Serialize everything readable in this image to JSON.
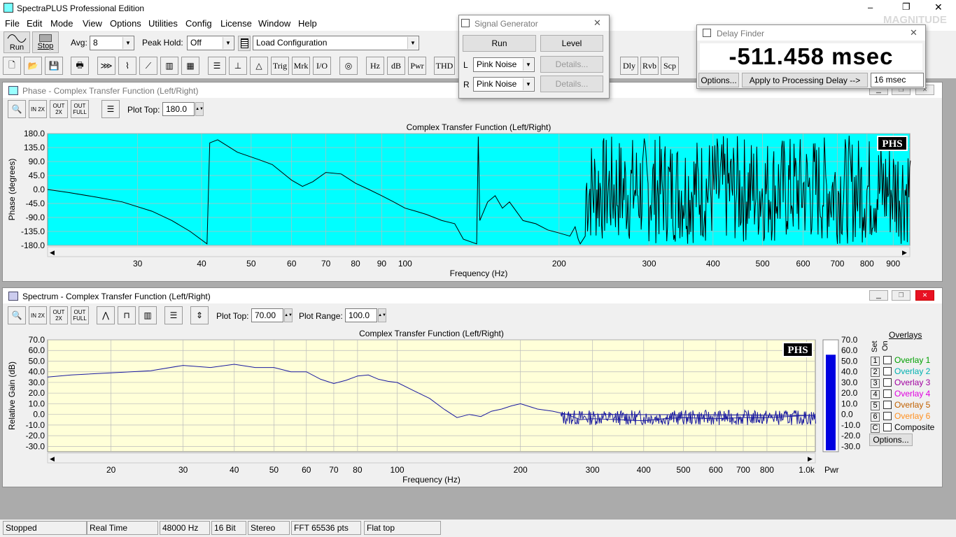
{
  "app": {
    "title": "SpectraPLUS Professional Edition"
  },
  "window_controls": {
    "minimize": "‒",
    "restore": "❐",
    "close": "✕"
  },
  "menu": [
    "File",
    "Edit",
    "Mode",
    "View",
    "Options",
    "Utilities",
    "Config",
    "License",
    "Window",
    "Help"
  ],
  "toolbar1": {
    "run": "Run",
    "stop": "Stop",
    "avg_label": "Avg:",
    "avg_value": "8",
    "peak_label": "Peak Hold:",
    "peak_value": "Off",
    "config_value": "Load Configuration"
  },
  "toolbar2": {
    "buttons": [
      "Trig",
      "Mrk",
      "I/O",
      "Hz",
      "dB",
      "Pwr",
      "THD",
      "Dly",
      "Rvb",
      "Scp"
    ]
  },
  "signal_generator": {
    "title": "Signal Generator",
    "run": "Run",
    "level": "Level",
    "l_label": "L",
    "r_label": "R",
    "l_value": "Pink Noise",
    "r_value": "Pink Noise",
    "details": "Details..."
  },
  "delay_finder": {
    "title": "Delay Finder",
    "value": "-511.458 msec",
    "options": "Options...",
    "apply": "Apply to Processing Delay -->",
    "delay_value": "16 msec"
  },
  "watermark": {
    "text": "MAGNITUDE Sound Team"
  },
  "phase_window": {
    "title": "Phase - Complex Transfer Function (Left/Right)",
    "plot_top_label": "Plot Top:",
    "plot_top_value": "180.0",
    "zoom_buttons": [
      "IN 2X",
      "OUT 2X",
      "OUT FULL"
    ],
    "badge": "PHS"
  },
  "spectrum_window": {
    "title": "Spectrum - Complex Transfer Function (Left/Right)",
    "plot_top_label": "Plot Top:",
    "plot_top_value": "70.00",
    "plot_range_label": "Plot Range:",
    "plot_range_value": "100.0",
    "zoom_buttons": [
      "IN 2X",
      "OUT 2X",
      "OUT FULL"
    ],
    "badge": "PHS",
    "pwr_label": "Pwr"
  },
  "overlays": {
    "title": "Overlays",
    "set_label": "Set",
    "on_label": "On",
    "items": [
      {
        "num": "1",
        "label": "Overlay 1",
        "color": "#00a000"
      },
      {
        "num": "2",
        "label": "Overlay 2",
        "color": "#00b0b0"
      },
      {
        "num": "3",
        "label": "Overlay 3",
        "color": "#a000a0"
      },
      {
        "num": "4",
        "label": "Overlay 4",
        "color": "#e000e0"
      },
      {
        "num": "5",
        "label": "Overlay 5",
        "color": "#c06000"
      },
      {
        "num": "6",
        "label": "Overlay 6",
        "color": "#ff9020"
      },
      {
        "num": "C",
        "label": "Composite",
        "color": "#000000"
      }
    ],
    "options": "Options..."
  },
  "status": [
    "Stopped",
    "Real Time",
    "48000 Hz",
    "16 Bit",
    "Stereo",
    "FFT 65536 pts",
    "Flat top"
  ],
  "chart_data": [
    {
      "type": "line",
      "title": "Complex Transfer Function (Left/Right)",
      "xlabel": "Frequency (Hz)",
      "ylabel": "Phase (degrees)",
      "x_scale": "log",
      "xlim": [
        20,
        970
      ],
      "ylim": [
        -180,
        180
      ],
      "yticks": [
        "180.0",
        "135.0",
        "90.0",
        "45.0",
        "0.0",
        "-45.0",
        "-90.0",
        "-135.0",
        "-180.0"
      ],
      "xticks": [
        "30",
        "40",
        "50",
        "60",
        "70",
        "80",
        "90",
        "100",
        "200",
        "300",
        "400",
        "500",
        "600",
        "700",
        "800",
        "900"
      ],
      "background": "#00ffff",
      "line_color": "#000000",
      "series": [
        {
          "x": [
            20,
            22,
            25,
            28,
            32,
            35,
            38,
            41,
            41.5,
            43,
            47,
            52,
            55,
            60,
            63,
            66,
            70,
            75,
            80,
            85,
            90,
            95,
            100,
            105,
            110,
            118,
            125,
            130,
            138,
            139,
            140,
            145,
            150,
            155,
            160,
            170,
            180,
            190,
            200,
            210,
            215,
            218,
            220,
            225
          ],
          "y": [
            0,
            -10,
            -25,
            -40,
            -70,
            -100,
            -135,
            -175,
            150,
            160,
            120,
            95,
            80,
            30,
            10,
            25,
            55,
            50,
            20,
            0,
            -20,
            -40,
            -60,
            -70,
            -80,
            -100,
            -110,
            -160,
            -175,
            170,
            -100,
            -40,
            -20,
            -60,
            -40,
            -100,
            -110,
            -130,
            -140,
            -150,
            -120,
            -160,
            -175,
            -150
          ]
        }
      ]
    },
    {
      "type": "line",
      "title": "Complex Transfer Function (Left/Right)",
      "xlabel": "Frequency (Hz)",
      "ylabel": "Relative Gain (dB)",
      "x_scale": "log",
      "xlim": [
        14,
        1050
      ],
      "ylim": [
        -35,
        70
      ],
      "yticks": [
        "70.0",
        "60.0",
        "50.0",
        "40.0",
        "30.0",
        "20.0",
        "10.0",
        "0.0",
        "-10.0",
        "-20.0",
        "-30.0"
      ],
      "xticks": [
        "20",
        "30",
        "40",
        "50",
        "60",
        "70",
        "80",
        "100",
        "200",
        "300",
        "400",
        "500",
        "600",
        "700",
        "800",
        "1.0k"
      ],
      "background": "#ffffd8",
      "line_color": "#1a1aa0",
      "series": [
        {
          "x": [
            14,
            16,
            20,
            25,
            30,
            35,
            40,
            45,
            50,
            55,
            60,
            65,
            70,
            75,
            80,
            85,
            90,
            95,
            100,
            110,
            120,
            130,
            140,
            150,
            160,
            170,
            180,
            190,
            200,
            220,
            240,
            260,
            280,
            300,
            350,
            400,
            450,
            500,
            600,
            700,
            800,
            900,
            1000,
            1050
          ],
          "y": [
            35,
            37,
            39,
            41,
            46,
            44,
            47,
            44,
            44,
            40,
            40,
            33,
            29,
            32,
            36,
            37,
            33,
            31,
            30,
            22,
            15,
            5,
            -3,
            0,
            -2,
            3,
            5,
            8,
            10,
            5,
            3,
            0,
            -5,
            -4,
            -5,
            -6,
            -4,
            -3,
            -4,
            -3,
            -3,
            -2,
            -1,
            -1
          ]
        }
      ],
      "level_meter": {
        "label": "Pwr",
        "yticks": [
          "70.0",
          "60.0",
          "50.0",
          "40.0",
          "30.0",
          "20.0",
          "10.0",
          "0.0",
          "-10.0",
          "-20.0",
          "-30.0"
        ],
        "value": 56,
        "color": "#0000e0"
      }
    }
  ]
}
